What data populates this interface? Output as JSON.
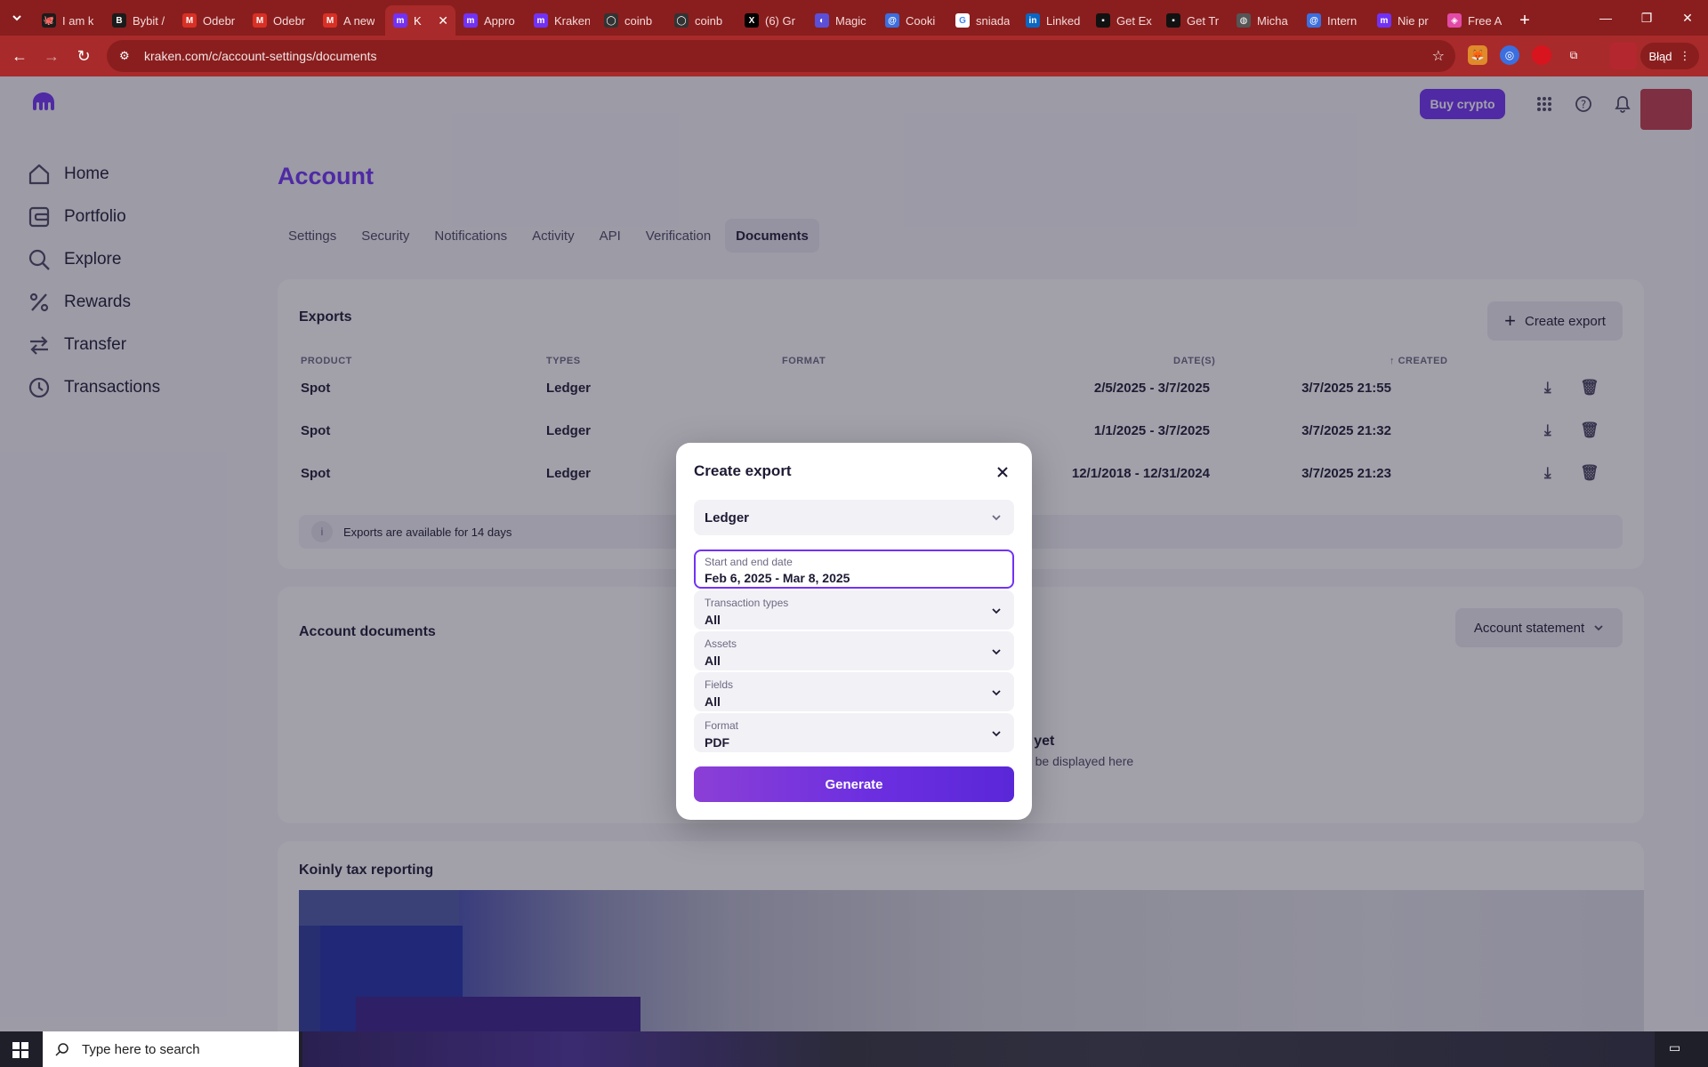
{
  "browser": {
    "tabs": [
      {
        "label": "I am k",
        "fav_color": "#1b1b1b",
        "glyph": "🐙"
      },
      {
        "label": "Bybit /",
        "fav_color": "#1b1b1b",
        "glyph": "B"
      },
      {
        "label": "Odebr",
        "fav_color": "#d93025",
        "glyph": "M"
      },
      {
        "label": "Odebr",
        "fav_color": "#d93025",
        "glyph": "M"
      },
      {
        "label": "A new",
        "fav_color": "#d93025",
        "glyph": "M"
      },
      {
        "label": "K",
        "fav_color": "#7132f5",
        "glyph": "m",
        "active": true
      },
      {
        "label": "Appro",
        "fav_color": "#7132f5",
        "glyph": "m"
      },
      {
        "label": "Kraken",
        "fav_color": "#7132f5",
        "glyph": "m"
      },
      {
        "label": "coinb",
        "fav_color": "#333333",
        "glyph": "◯"
      },
      {
        "label": "coinb",
        "fav_color": "#333333",
        "glyph": "◯"
      },
      {
        "label": "(6) Gr",
        "fav_color": "#000000",
        "glyph": "X"
      },
      {
        "label": "Magic",
        "fav_color": "#5b4fd8",
        "glyph": "◐"
      },
      {
        "label": "Cooki",
        "fav_color": "#3b6fe0",
        "glyph": "@"
      },
      {
        "label": "sniada",
        "fav_color": "#ffffff",
        "glyph": "G"
      },
      {
        "label": "Linked",
        "fav_color": "#0a66c2",
        "glyph": "in"
      },
      {
        "label": "Get Ex",
        "fav_color": "#111111",
        "glyph": "▪"
      },
      {
        "label": "Get Tr",
        "fav_color": "#111111",
        "glyph": "▪"
      },
      {
        "label": "Micha",
        "fav_color": "#555555",
        "glyph": "◍"
      },
      {
        "label": "Intern",
        "fav_color": "#3b6fe0",
        "glyph": "@"
      },
      {
        "label": "Nie pr",
        "fav_color": "#7132f5",
        "glyph": "m"
      },
      {
        "label": "Free A",
        "fav_color": "#e24aa8",
        "glyph": "◈"
      }
    ],
    "url": "kraken.com/c/account-settings/documents",
    "profile_label": "Błąd"
  },
  "header": {
    "buy_label": "Buy crypto"
  },
  "sidebar": {
    "items": [
      {
        "label": "Home",
        "icon": "home-icon"
      },
      {
        "label": "Portfolio",
        "icon": "portfolio-icon"
      },
      {
        "label": "Explore",
        "icon": "search-icon"
      },
      {
        "label": "Rewards",
        "icon": "percent-icon"
      },
      {
        "label": "Transfer",
        "icon": "transfer-icon"
      },
      {
        "label": "Transactions",
        "icon": "clock-icon"
      }
    ]
  },
  "account": {
    "title": "Account",
    "tabs": [
      "Settings",
      "Security",
      "Notifications",
      "Activity",
      "API",
      "Verification",
      "Documents"
    ],
    "active_tab": "Documents"
  },
  "exports": {
    "title": "Exports",
    "create_label": "Create export",
    "columns": {
      "product": "PRODUCT",
      "types": "TYPES",
      "format": "FORMAT",
      "dates": "DATE(S)",
      "created": "CREATED"
    },
    "rows": [
      {
        "product": "Spot",
        "types": "Ledger",
        "dates": "2/5/2025 - 3/7/2025",
        "created_date": "3/7/2025",
        "created_time": "21:55"
      },
      {
        "product": "Spot",
        "types": "Ledger",
        "dates": "1/1/2025 - 3/7/2025",
        "created_date": "3/7/2025",
        "created_time": "21:32"
      },
      {
        "product": "Spot",
        "types": "Ledger",
        "dates": "12/1/2018 - 12/31/2024",
        "created_date": "3/7/2025",
        "created_time": "21:23"
      }
    ],
    "notice": "Exports are available for 14 days"
  },
  "documents": {
    "title": "Account documents",
    "dropdown_label": "Account statement",
    "empty_title": "No documents available yet",
    "empty_sub": "If you qualify for receiving a document, it will be displayed here"
  },
  "koinly": {
    "title": "Koinly tax reporting"
  },
  "modal": {
    "title": "Create export",
    "product_value": "Ledger",
    "date_label": "Start and end date",
    "date_value": "Feb 6, 2025 - Mar 8, 2025",
    "fields": [
      {
        "label": "Transaction types",
        "value": "All"
      },
      {
        "label": "Assets",
        "value": "All"
      },
      {
        "label": "Fields",
        "value": "All"
      },
      {
        "label": "Format",
        "value": "PDF"
      }
    ],
    "generate_label": "Generate"
  },
  "taskbar": {
    "search_placeholder": "Type here to search"
  },
  "colors": {
    "brand": "#7132f5",
    "browser_frame": "#a92a2a"
  }
}
